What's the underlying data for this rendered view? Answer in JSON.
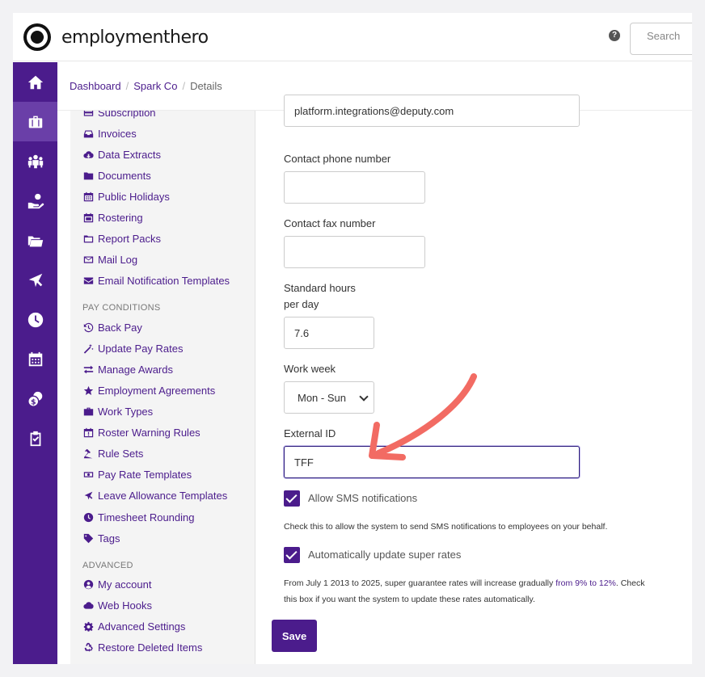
{
  "header": {
    "brand": "employmenthero",
    "help_label": "?",
    "search_placeholder": "Search"
  },
  "breadcrumb": {
    "items": [
      "Dashboard",
      "Spark Co"
    ],
    "current": "Details"
  },
  "rail": {
    "icons": [
      "home-icon",
      "briefcase-icon",
      "people-icon",
      "hand-money-icon",
      "folders-icon",
      "plane-icon",
      "clock-icon",
      "calendar-icon",
      "coins-icon",
      "clipboard-icon"
    ],
    "active_index": 1
  },
  "menu": {
    "group1": [
      {
        "label": "Subscription",
        "icon": "card-icon"
      },
      {
        "label": "Invoices",
        "icon": "inbox-icon"
      },
      {
        "label": "Data Extracts",
        "icon": "cloud-download-icon"
      },
      {
        "label": "Documents",
        "icon": "folder-icon"
      },
      {
        "label": "Public Holidays",
        "icon": "calendar-icon"
      },
      {
        "label": "Rostering",
        "icon": "calendar-grid-icon"
      },
      {
        "label": "Report Packs",
        "icon": "folder-outline-icon"
      },
      {
        "label": "Mail Log",
        "icon": "envelope-outline-icon"
      },
      {
        "label": "Email Notification Templates",
        "icon": "envelope-icon"
      }
    ],
    "pay_conditions_heading": "PAY CONDITIONS",
    "group2": [
      {
        "label": "Back Pay",
        "icon": "history-icon"
      },
      {
        "label": "Update Pay Rates",
        "icon": "magic-icon"
      },
      {
        "label": "Manage Awards",
        "icon": "exchange-icon"
      },
      {
        "label": "Employment Agreements",
        "icon": "star-icon"
      },
      {
        "label": "Work Types",
        "icon": "briefcase-icon"
      },
      {
        "label": "Roster Warning Rules",
        "icon": "calendar-warning-icon"
      },
      {
        "label": "Rule Sets",
        "icon": "gavel-icon"
      },
      {
        "label": "Pay Rate Templates",
        "icon": "money-icon"
      },
      {
        "label": "Leave Allowance Templates",
        "icon": "plane-icon"
      },
      {
        "label": "Timesheet Rounding",
        "icon": "clock-icon"
      },
      {
        "label": "Tags",
        "icon": "tag-icon"
      }
    ],
    "advanced_heading": "ADVANCED",
    "group3": [
      {
        "label": "My account",
        "icon": "user-circle-icon"
      },
      {
        "label": "Web Hooks",
        "icon": "cloud-icon"
      },
      {
        "label": "Advanced Settings",
        "icon": "gear-icon"
      },
      {
        "label": "Restore Deleted Items",
        "icon": "recycle-icon"
      }
    ]
  },
  "form": {
    "email_value": "platform.integrations@deputy.com",
    "phone_label": "Contact phone number",
    "phone_value": "",
    "fax_label": "Contact fax number",
    "fax_value": "",
    "hours_label_line1": "Standard hours",
    "hours_label_line2": "per day",
    "hours_value": "7.6",
    "work_week_label": "Work week",
    "work_week_value": "Mon - Sun",
    "external_id_label": "External ID",
    "external_id_value": "TFF",
    "sms_label": "Allow SMS notifications",
    "sms_checked": true,
    "sms_help": "Check this to allow the system to send SMS notifications to employees on your behalf.",
    "super_label": "Automatically update super rates",
    "super_checked": true,
    "super_help_1": "From July 1 2013 to 2025, super guarantee rates will increase gradually ",
    "super_help_link": "from 9% to 12%",
    "super_help_2": ". Check",
    "super_help_3": "this box if you want the system to update these rates automatically.",
    "save_label": "Save"
  },
  "colors": {
    "brand_purple": "#4b1c8c",
    "rail_active": "#6a3fa8",
    "arrow": "#f26b63"
  }
}
